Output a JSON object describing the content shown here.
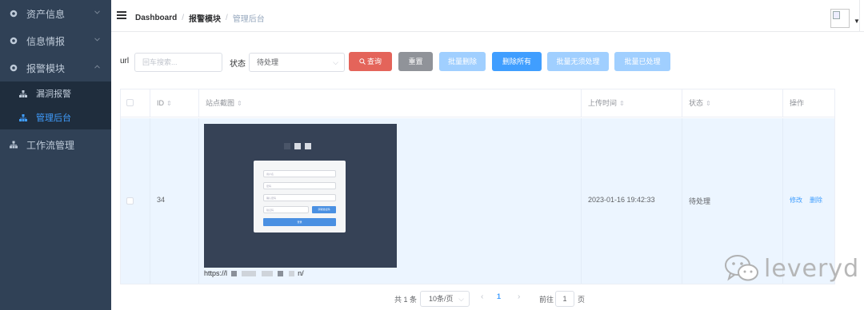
{
  "sidebar": {
    "menu": [
      {
        "label": "资产信息",
        "icon": "gear-icon",
        "expanded": false
      },
      {
        "label": "信息情报",
        "icon": "gear-icon",
        "expanded": false
      },
      {
        "label": "报警模块",
        "icon": "gear-icon",
        "expanded": true
      }
    ],
    "submenu": [
      {
        "label": "漏洞报警",
        "icon": "sitemap-icon",
        "active": false
      },
      {
        "label": "管理后台",
        "icon": "sitemap-icon",
        "active": true
      }
    ],
    "lower_item": {
      "label": "工作流管理",
      "icon": "sitemap-icon"
    }
  },
  "header": {
    "breadcrumb": [
      "Dashboard",
      "报警模块",
      "管理后台"
    ]
  },
  "filters": {
    "url_label": "url",
    "url_placeholder": "回车搜索...",
    "status_label": "状态",
    "status_value": "待处理"
  },
  "buttons": {
    "search": "查询",
    "reset": "重置",
    "batch_delete": "批量删除",
    "delete_all": "删除所有",
    "batch_no_action": "批量无须处理",
    "batch_processed": "批量已处理"
  },
  "table": {
    "columns": [
      "ID",
      "站点截图",
      "上传时间",
      "状态",
      "操作"
    ],
    "rows": [
      {
        "id": "34",
        "screenshot_url_prefix": "https://l",
        "screenshot_url_suffix": "n/",
        "thumb": {
          "fields": [
            "用户名",
            "密码",
            "确认密码"
          ],
          "code_placeholder": "验证码",
          "code_button": "获取验证码",
          "login_button": "登录"
        },
        "upload_time": "2023-01-16 19:42:33",
        "status": "待处理",
        "actions": {
          "edit": "修改",
          "delete": "删除"
        }
      }
    ]
  },
  "pagination": {
    "total": "共 1 条",
    "page_size": "10条/页",
    "current_page": "1",
    "goto_label": "前往",
    "goto_value": "1",
    "page_unit": "页"
  },
  "watermark": "leveryd",
  "colors": {
    "sidebar_bg": "#304156",
    "accent": "#409eff",
    "danger": "#e4645a",
    "row_highlight": "#ecf5ff"
  }
}
